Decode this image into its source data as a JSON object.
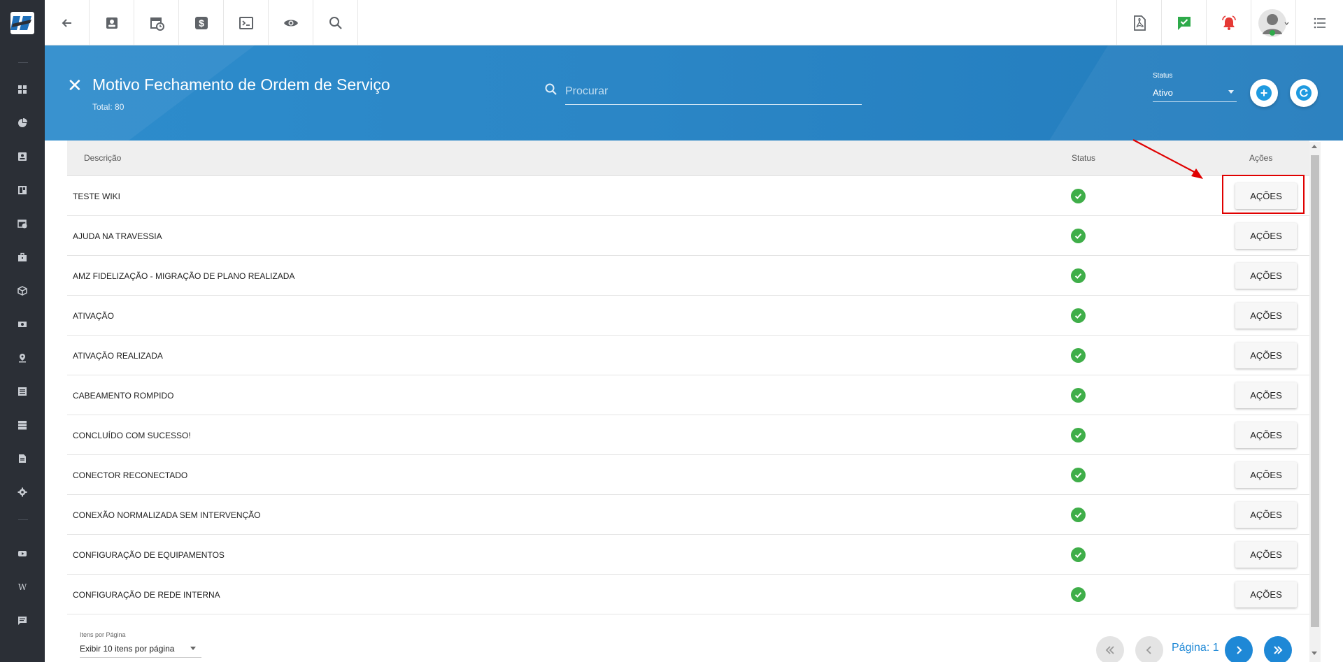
{
  "sidebar": {
    "icons": [
      "dashboard-icon",
      "chart-pie-icon",
      "contact-card-icon",
      "board-icon",
      "calendar-clock-icon",
      "briefcase-icon",
      "cube-icon",
      "money-icon",
      "map-pin-icon",
      "list-icon",
      "server-icon",
      "document-icon",
      "settings-icon",
      "youtube-icon",
      "wiki-icon",
      "chat-icon"
    ],
    "wiki_glyph": "W"
  },
  "topbar": {
    "left_icons": [
      "back-arrow-icon",
      "contact-icon",
      "calendar-icon",
      "dollar-icon",
      "terminal-icon",
      "eye-icon",
      "search-icon"
    ],
    "right_icons": [
      "pdf-icon",
      "message-check-icon",
      "alarm-icon",
      "user-avatar-icon",
      "menu-list-icon"
    ],
    "colors": {
      "message": "#2eaa4a",
      "alarm": "#e53935"
    }
  },
  "header": {
    "title": "Motivo Fechamento de Ordem de Serviço",
    "total": "Total: 80",
    "search_placeholder": "Procurar",
    "status_label": "Status",
    "status_value": "Ativo"
  },
  "table": {
    "headers": {
      "description": "Descrição",
      "status": "Status",
      "actions": "Ações"
    },
    "action_label": "AÇÕES",
    "rows": [
      {
        "description": "TESTE WIKI",
        "status": "active"
      },
      {
        "description": "AJUDA NA TRAVESSIA",
        "status": "active"
      },
      {
        "description": "AMZ FIDELIZAÇÃO - MIGRAÇÃO DE PLANO REALIZADA",
        "status": "active"
      },
      {
        "description": "ATIVAÇÃO",
        "status": "active"
      },
      {
        "description": "ATIVAÇÃO REALIZADA",
        "status": "active"
      },
      {
        "description": "CABEAMENTO ROMPIDO",
        "status": "active"
      },
      {
        "description": "CONCLUÍDO COM SUCESSO!",
        "status": "active"
      },
      {
        "description": "CONECTOR RECONECTADO",
        "status": "active"
      },
      {
        "description": "CONEXÃO NORMALIZADA SEM INTERVENÇÃO",
        "status": "active"
      },
      {
        "description": "CONFIGURAÇÃO DE EQUIPAMENTOS",
        "status": "active"
      },
      {
        "description": "CONFIGURAÇÃO DE REDE INTERNA",
        "status": "active"
      }
    ]
  },
  "footer": {
    "items_per_page_label": "Itens por Página",
    "items_per_page_value": "Exibir 10 itens por página",
    "page_label": "Página: 1"
  },
  "colors": {
    "accent": "#1e88d6",
    "banner": "#2b86c6",
    "status_ok": "#3fae49",
    "annotation": "#e00000"
  }
}
